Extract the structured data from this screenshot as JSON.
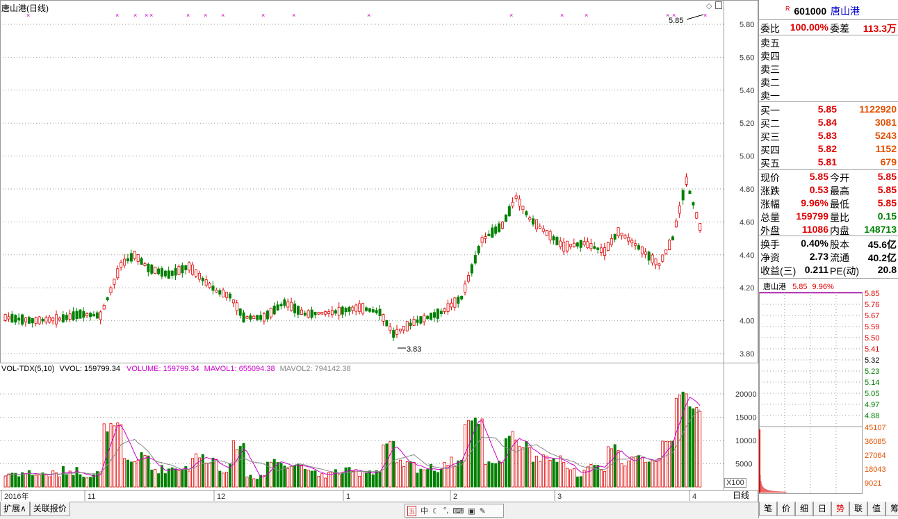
{
  "header": {
    "name": "唐山港",
    "period": "(日线)"
  },
  "quote": {
    "code": "601000",
    "name": "唐山港",
    "r_mark": "R",
    "weibi_label": "委比",
    "weibi": "100.00%",
    "weicha_label": "委差",
    "weicha": "113.3万",
    "sells": [
      {
        "label": "卖五"
      },
      {
        "label": "卖四"
      },
      {
        "label": "卖三"
      },
      {
        "label": "卖二"
      },
      {
        "label": "卖一"
      }
    ],
    "buys": [
      {
        "label": "买一",
        "price": "5.85",
        "vol": "1122920"
      },
      {
        "label": "买二",
        "price": "5.84",
        "vol": "3081"
      },
      {
        "label": "买三",
        "price": "5.83",
        "vol": "5243"
      },
      {
        "label": "买四",
        "price": "5.82",
        "vol": "1152"
      },
      {
        "label": "买五",
        "price": "5.81",
        "vol": "679"
      }
    ],
    "stats": [
      {
        "l1": "现价",
        "v1": "5.85",
        "c1": "red",
        "l2": "今开",
        "v2": "5.85",
        "c2": "red"
      },
      {
        "l1": "涨跌",
        "v1": "0.53",
        "c1": "red",
        "l2": "最高",
        "v2": "5.85",
        "c2": "red"
      },
      {
        "l1": "涨幅",
        "v1": "9.96%",
        "c1": "red",
        "l2": "最低",
        "v2": "5.85",
        "c2": "red"
      },
      {
        "l1": "总量",
        "v1": "159799",
        "c1": "red",
        "l2": "量比",
        "v2": "0.15",
        "c2": "green"
      },
      {
        "l1": "外盘",
        "v1": "11086",
        "c1": "red",
        "l2": "内盘",
        "v2": "148713",
        "c2": "green"
      },
      {
        "l1": "换手",
        "v1": "0.40%",
        "c1": "black",
        "l2": "股本",
        "v2": "45.6亿",
        "c2": "black"
      },
      {
        "l1": "净资",
        "v1": "2.73",
        "c1": "black",
        "l2": "流通",
        "v2": "40.2亿",
        "c2": "black"
      },
      {
        "l1": "收益(三)",
        "v1": "0.211",
        "c1": "black",
        "l2": "PE(动)",
        "v2": "20.8",
        "c2": "black"
      }
    ]
  },
  "mini": {
    "name": "唐山港",
    "price": "5.85",
    "pct": "9.96%",
    "price_labels": [
      "5.85",
      "5.76",
      "5.67",
      "5.59",
      "5.50",
      "5.41",
      "5.32",
      "5.23",
      "5.14",
      "5.05",
      "4.97",
      "4.88"
    ],
    "vol_labels": [
      "45107",
      "36085",
      "27064",
      "18043",
      "9021"
    ]
  },
  "chart": {
    "price_axis": [
      "5.80",
      "5.60",
      "5.40",
      "5.20",
      "5.00",
      "4.80",
      "4.60",
      "4.40",
      "4.20",
      "4.00",
      "3.80"
    ],
    "vol_axis": [
      "20000",
      "15000",
      "10000",
      "5000"
    ],
    "vol_unit": "X100",
    "low_label": "3.83",
    "high_label": "5.85",
    "vol_header": {
      "title": "VOL-TDX(5,10)",
      "vvol": "VVOL: 159799.34",
      "volume": "VOLUME: 159799.34",
      "mavol1": "MAVOL1: 655094.38",
      "mavol2": "MAVOL2: 794142.38"
    },
    "x_labels": [
      "2016年",
      "11",
      "12",
      "1",
      "2",
      "3",
      "4"
    ]
  },
  "bottom": {
    "tabs": [
      "扩展∧",
      "关联报价"
    ],
    "period": "日线",
    "right_tabs": [
      "笔",
      "价",
      "细",
      "日",
      "势",
      "联",
      "值",
      "筹"
    ]
  },
  "colors": {
    "up": "#e00000",
    "down": "#008000",
    "grid": "#999999",
    "ma1": "#cc00cc",
    "ma2": "#888888"
  }
}
